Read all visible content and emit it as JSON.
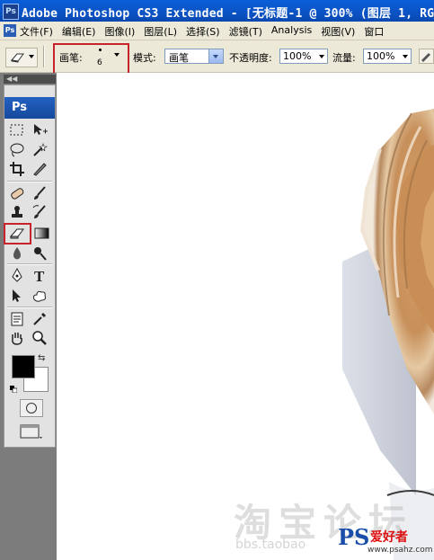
{
  "window": {
    "title": "Adobe Photoshop CS3 Extended - [无标题-1 @ 300% (图层 1, RG",
    "app_badge": "Ps"
  },
  "menu": {
    "app_icon": "Ps",
    "items": [
      "文件(F)",
      "编辑(E)",
      "图像(I)",
      "图层(L)",
      "选择(S)",
      "滤镜(T)",
      "Analysis",
      "视图(V)",
      "窗口"
    ]
  },
  "options": {
    "brush_label": "画笔:",
    "brush_size": "6",
    "mode_label": "模式:",
    "mode_value": "画笔",
    "opacity_label": "不透明度:",
    "opacity_value": "100%",
    "flow_label": "流量:",
    "flow_value": "100%"
  },
  "toolbox": {
    "logo": "Ps",
    "foreground_color": "#000000",
    "background_color": "#ffffff"
  },
  "accent_colors": {
    "highlight": "#c8232c",
    "titlebar": "#0b52c4"
  },
  "watermark": {
    "text": "淘宝论坛",
    "url": "bbs.taobao",
    "logo_ps": "PS",
    "logo_cn": "爱好者",
    "logo_url": "www.psahz.com"
  }
}
